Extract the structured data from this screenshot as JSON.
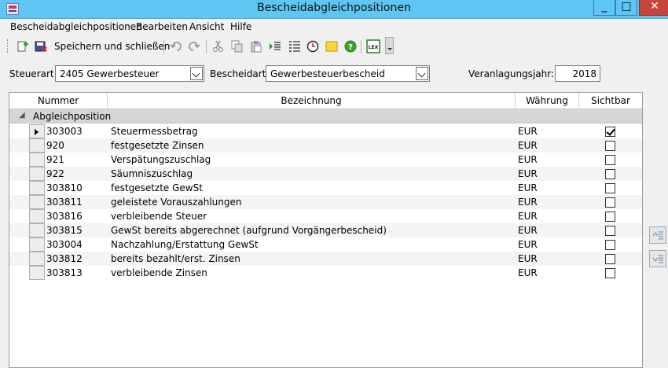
{
  "window": {
    "title": "Bescheidabgleichpositionen",
    "minimize_glyph": "_",
    "maximize_glyph": "□",
    "close_glyph": "✕"
  },
  "menu": [
    "Bescheidabgleichpositionen",
    "Bearbeiten",
    "Ansicht",
    "Hilfe"
  ],
  "toolbar": {
    "save_close_label": "Speichern und schließen",
    "icons": [
      "new-icon",
      "save-close-icon",
      "undo-icon",
      "redo-icon",
      "cut-icon",
      "copy-icon",
      "paste-icon",
      "indent-icon",
      "list-icon",
      "clock-icon",
      "note-icon",
      "help-icon",
      "lex-icon"
    ],
    "lex_text": "LEX"
  },
  "filters": {
    "steuerart_label": "Steuerart:",
    "steuerart_value": "2405   Gewerbesteuer",
    "bescheidart_label": "Bescheidart:",
    "bescheidart_value": "Gewerbesteuerbescheid",
    "jahr_label": "Veranlagungsjahr:",
    "jahr_value": "2018"
  },
  "grid": {
    "columns": [
      "Nummer",
      "Bezeichnung",
      "Währung",
      "Sichtbar"
    ],
    "group_label": "Abgleichposition",
    "group_toggle": "◢",
    "rows": [
      {
        "nummer": "303003",
        "bezeichnung": "Steuermessbetrag",
        "waehrung": "EUR",
        "sichtbar": true
      },
      {
        "nummer": "920",
        "bezeichnung": "festgesetzte Zinsen",
        "waehrung": "EUR",
        "sichtbar": false
      },
      {
        "nummer": "921",
        "bezeichnung": "Verspätungszuschlag",
        "waehrung": "EUR",
        "sichtbar": false
      },
      {
        "nummer": "922",
        "bezeichnung": "Säumniszuschlag",
        "waehrung": "EUR",
        "sichtbar": false
      },
      {
        "nummer": "303810",
        "bezeichnung": "festgesetzte GewSt",
        "waehrung": "EUR",
        "sichtbar": false
      },
      {
        "nummer": "303811",
        "bezeichnung": "geleistete Vorauszahlungen",
        "waehrung": "EUR",
        "sichtbar": false
      },
      {
        "nummer": "303816",
        "bezeichnung": "verbleibende Steuer",
        "waehrung": "EUR",
        "sichtbar": false
      },
      {
        "nummer": "303815",
        "bezeichnung": "GewSt bereits abgerechnet (aufgrund Vorgängerbescheid)",
        "waehrung": "EUR",
        "sichtbar": false
      },
      {
        "nummer": "303004",
        "bezeichnung": "Nachzahlung/Erstattung GewSt",
        "waehrung": "EUR",
        "sichtbar": false
      },
      {
        "nummer": "303812",
        "bezeichnung": "bereits bezahlt/erst. Zinsen",
        "waehrung": "EUR",
        "sichtbar": false
      },
      {
        "nummer": "303813",
        "bezeichnung": "verbleibende Zinsen",
        "waehrung": "EUR",
        "sichtbar": false
      }
    ]
  },
  "side_buttons": [
    "move-up-icon",
    "move-down-icon"
  ]
}
